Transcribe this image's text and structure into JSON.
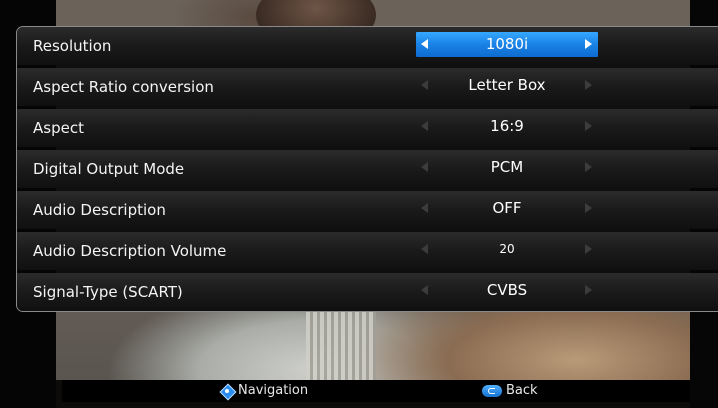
{
  "menu": {
    "rows": [
      {
        "label": "Resolution",
        "value": "1080i",
        "selected": true
      },
      {
        "label": "Aspect Ratio conversion",
        "value": "Letter Box"
      },
      {
        "label": "Aspect",
        "value": "16:9"
      },
      {
        "label": "Digital Output Mode",
        "value": "PCM"
      },
      {
        "label": "Audio Description",
        "value": "OFF"
      },
      {
        "label": "Audio Description Volume",
        "value": "20"
      },
      {
        "label": "Signal-Type (SCART)",
        "value": "CVBS"
      }
    ]
  },
  "footer": {
    "navigation_label": "Navigation",
    "back_label": "Back"
  },
  "colors": {
    "selected_value_bg": "#1a82e6",
    "row_bg": "#1a1a1a",
    "panel_border": "#8a8a8a"
  },
  "icons": {
    "navigation": "dpad-navigation-icon",
    "back": "return-back-icon",
    "left": "arrow-left-icon",
    "right": "arrow-right-icon"
  }
}
